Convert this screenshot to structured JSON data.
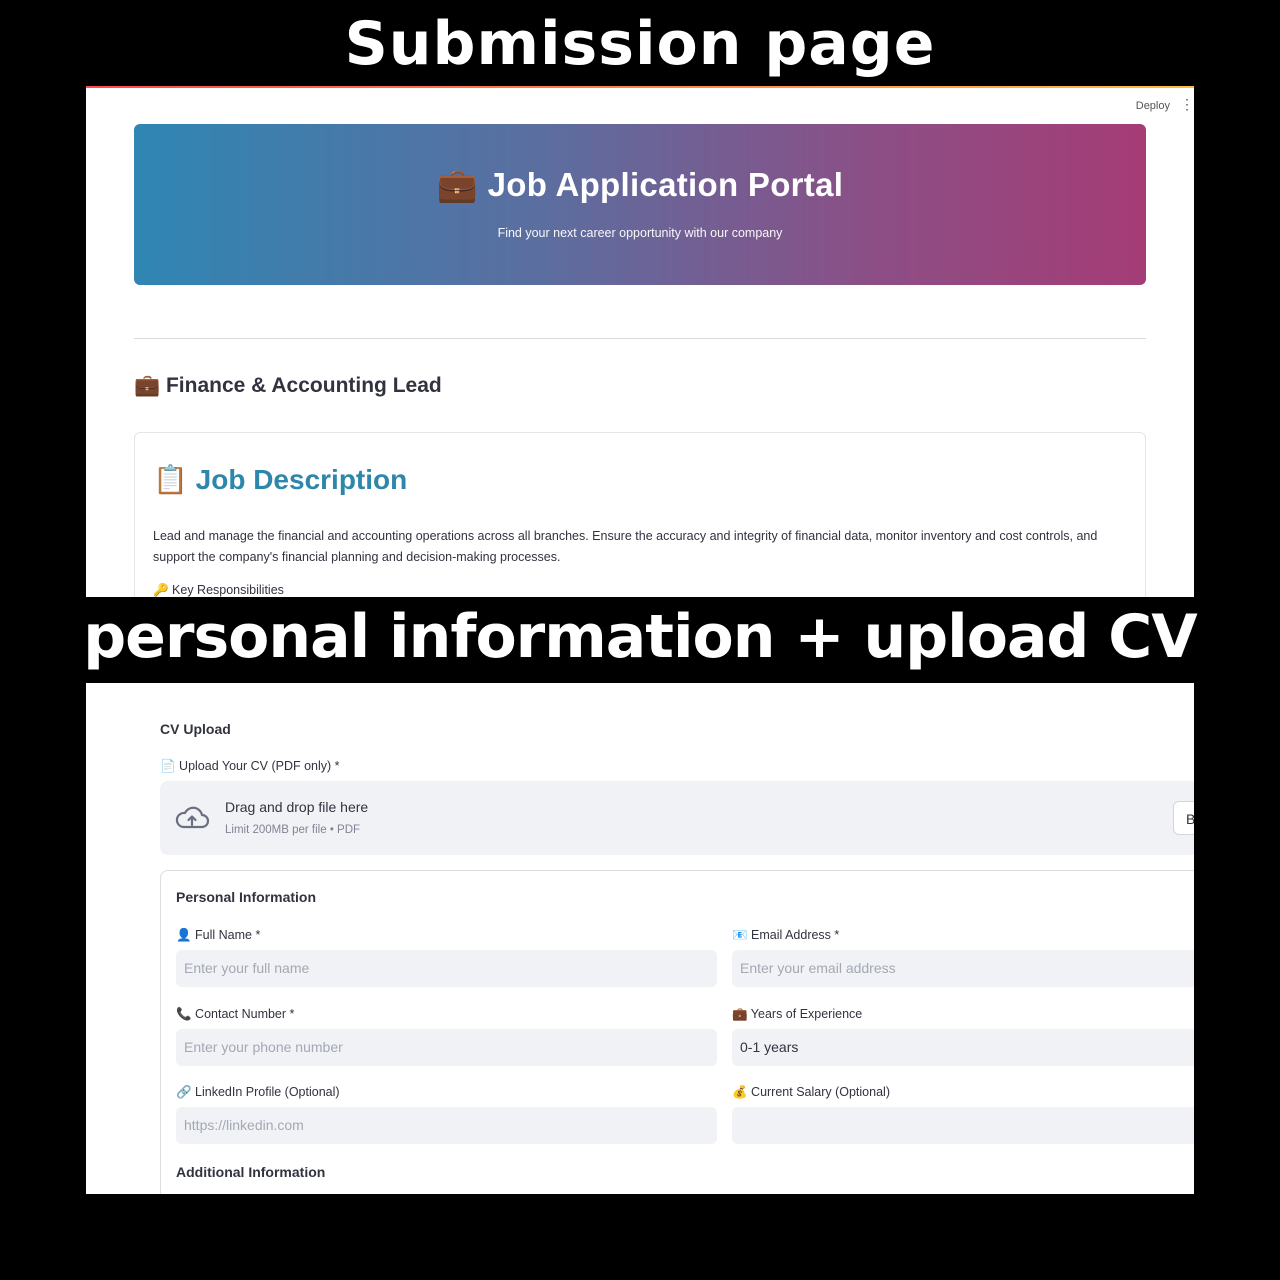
{
  "captions": {
    "top": "Submission page",
    "middle": "personal information + upload CV"
  },
  "app_header": {
    "deploy_label": "Deploy",
    "menu_icon": "kebab-menu-icon"
  },
  "hero": {
    "icon": "briefcase-icon",
    "title": "💼 Job Application Portal",
    "subtitle": "Find your next career opportunity with our company"
  },
  "job": {
    "title": "💼 Finance & Accounting Lead",
    "description_heading": "📋 Job Description",
    "description": "Lead and manage the financial and accounting operations across all branches. Ensure the accuracy and integrity of financial data, monitor inventory and cost controls, and support the company's financial planning and decision-making processes.",
    "key_responsibilities_label": "🔑 Key Responsibilities"
  },
  "cv_upload": {
    "heading": "CV Upload",
    "field_label": "📄 Upload Your CV (PDF only) *",
    "dropzone_main": "Drag and drop file here",
    "dropzone_limit": "Limit 200MB per file • PDF",
    "browse_label": "Browse files",
    "cloud_icon": "cloud-upload-icon"
  },
  "personal_info": {
    "heading": "Personal Information",
    "full_name": {
      "label": "👤 Full Name *",
      "placeholder": "Enter your full name"
    },
    "email": {
      "label": "📧 Email Address *",
      "placeholder": "Enter your email address"
    },
    "contact": {
      "label": "📞 Contact Number *",
      "placeholder": "Enter your phone number"
    },
    "experience": {
      "label": "💼 Years of Experience",
      "value": "0-1 years"
    },
    "linkedin": {
      "label": "🔗 LinkedIn Profile (Optional)",
      "placeholder": "https://linkedin.com"
    },
    "salary": {
      "label": "💰 Current Salary (Optional)",
      "value": ""
    }
  },
  "additional_info": {
    "heading": "Additional Information"
  },
  "colors": {
    "hero_gradient_start": "#2f86b3",
    "hero_gradient_end": "#a53c76",
    "heading_blue": "#2e86ab",
    "input_bg": "#f0f2f6",
    "text": "#31333f"
  }
}
